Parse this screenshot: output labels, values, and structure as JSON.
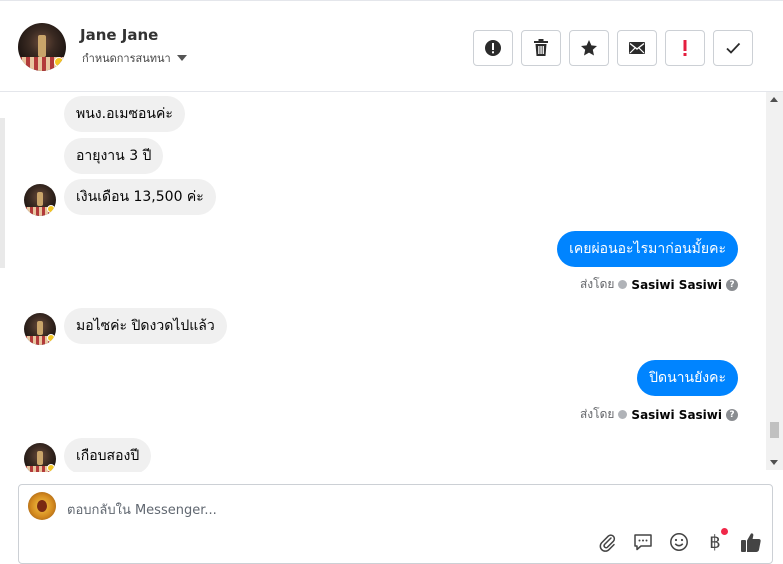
{
  "header": {
    "contact_name": "Jane Jane",
    "subtitle": "กำหนดการสนทนา",
    "actions": [
      {
        "name": "spam-button",
        "icon": "alert-circle-icon"
      },
      {
        "name": "delete-button",
        "icon": "trash-icon"
      },
      {
        "name": "star-button",
        "icon": "star-icon"
      },
      {
        "name": "unread-button",
        "icon": "envelope-icon"
      },
      {
        "name": "follow-up-button",
        "icon": "exclamation-icon"
      },
      {
        "name": "done-button",
        "icon": "check-icon"
      }
    ]
  },
  "messages": [
    {
      "dir": "in",
      "text": "พนง.อเมซอนค่ะ"
    },
    {
      "dir": "in",
      "text": "อายุงาน 3 ปี"
    },
    {
      "dir": "in",
      "text": "เงินเดือน 13,500 ค่ะ"
    },
    {
      "dir": "out",
      "text": "เคยผ่อนอะไรมาก่อนมั้ยคะ",
      "sent_by_label": "ส่งโดย",
      "sender": "Sasiwi Sasiwi"
    },
    {
      "dir": "in",
      "text": "มอไซค่ะ ปิดงวดไปแล้ว"
    },
    {
      "dir": "out",
      "text": "ปิดนานยังคะ",
      "sent_by_label": "ส่งโดย",
      "sender": "Sasiwi Sasiwi"
    },
    {
      "dir": "in",
      "text": "เกือบสองปี"
    }
  ],
  "composer": {
    "placeholder": "ตอบกลับใน Messenger...",
    "tools": [
      "paperclip-icon",
      "speech-bubble-icon",
      "smiley-icon",
      "baht-icon",
      "thumbs-up-icon"
    ],
    "baht_symbol": "฿"
  },
  "colors": {
    "outgoing_bubble": "#0084ff",
    "incoming_bubble": "#f0f0f0",
    "alert_red": "#e41e3f"
  }
}
